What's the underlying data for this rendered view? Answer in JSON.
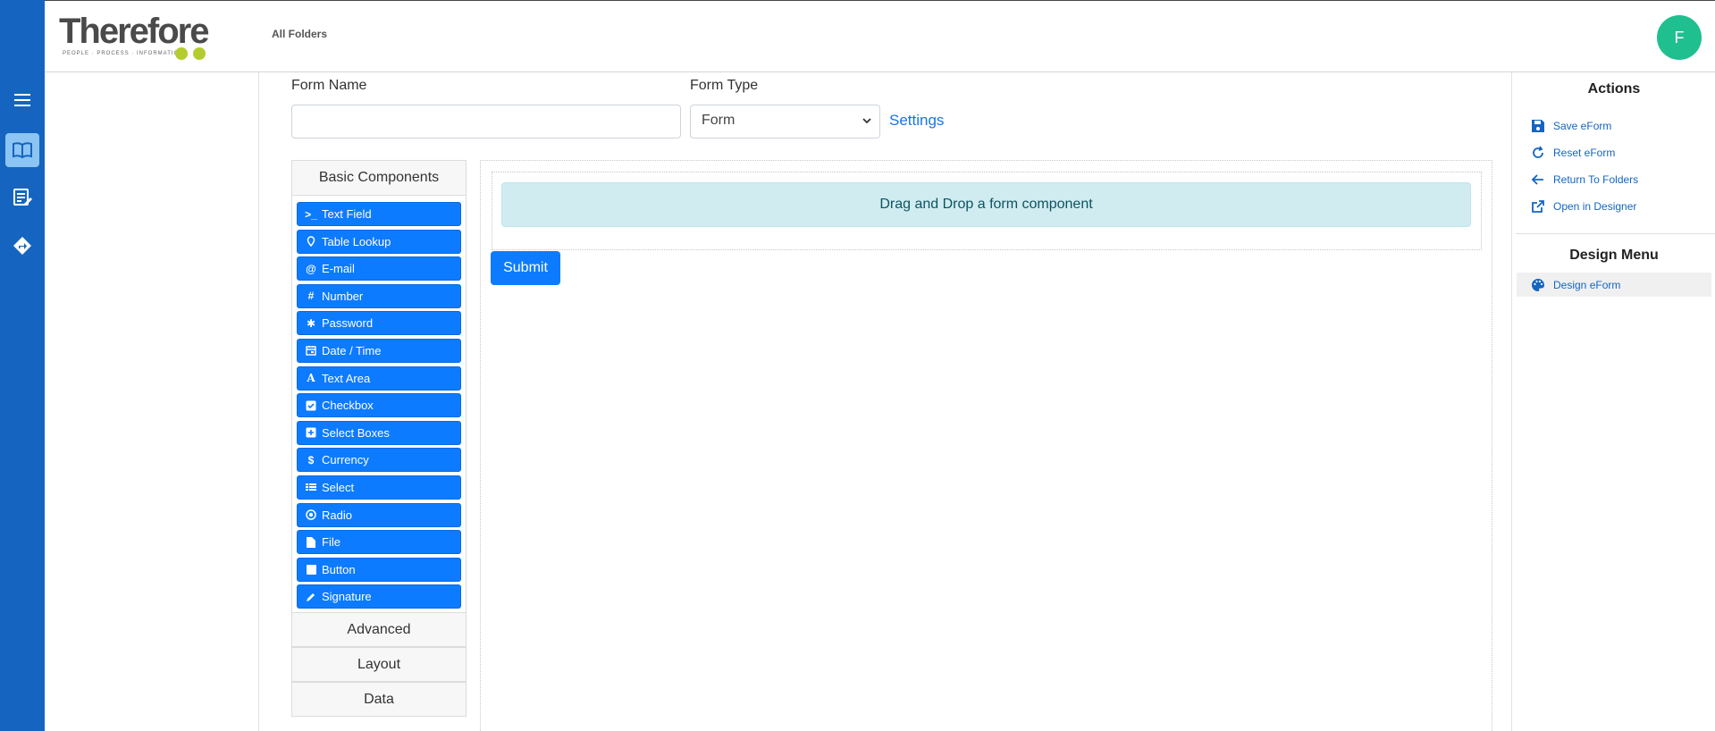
{
  "header": {
    "logo_text": "Therefore",
    "logo_tagline": "PEOPLE · PROCESS · INFORMATION",
    "breadcrumb": "All Folders",
    "avatar_initial": "F"
  },
  "rail": {
    "icons": [
      "menu-icon",
      "book-icon",
      "edit-list-icon",
      "directions-icon"
    ],
    "accent_color": "#1565c0"
  },
  "form": {
    "name_label": "Form Name",
    "name_value": "",
    "type_label": "Form Type",
    "type_value": "Form",
    "settings_link": "Settings"
  },
  "components": {
    "basic_header": "Basic Components",
    "items": [
      {
        "label": "Text Field",
        "icon": "terminal-icon"
      },
      {
        "label": "Table Lookup",
        "icon": "map-marker-icon"
      },
      {
        "label": "E-mail",
        "icon": "at-icon"
      },
      {
        "label": "Number",
        "icon": "hashtag-icon"
      },
      {
        "label": "Password",
        "icon": "asterisk-icon"
      },
      {
        "label": "Date / Time",
        "icon": "calendar-icon"
      },
      {
        "label": "Text Area",
        "icon": "font-icon"
      },
      {
        "label": "Checkbox",
        "icon": "check-square-icon"
      },
      {
        "label": "Select Boxes",
        "icon": "plus-square-icon"
      },
      {
        "label": "Currency",
        "icon": "dollar-icon"
      },
      {
        "label": "Select",
        "icon": "list-icon"
      },
      {
        "label": "Radio",
        "icon": "dot-circle-icon"
      },
      {
        "label": "File",
        "icon": "file-icon"
      },
      {
        "label": "Button",
        "icon": "stop-icon"
      },
      {
        "label": "Signature",
        "icon": "pencil-icon"
      }
    ],
    "advanced_header": "Advanced",
    "layout_header": "Layout",
    "data_header": "Data",
    "button_color": "#0d7bff"
  },
  "canvas": {
    "dropzone_text": "Drag and Drop a form component",
    "submit_label": "Submit"
  },
  "actions": {
    "title": "Actions",
    "items": [
      {
        "label": "Save eForm",
        "icon": "save-icon"
      },
      {
        "label": "Reset eForm",
        "icon": "refresh-icon"
      },
      {
        "label": "Return To Folders",
        "icon": "arrow-left-icon"
      },
      {
        "label": "Open in Designer",
        "icon": "external-link-icon"
      }
    ]
  },
  "design_menu": {
    "title": "Design Menu",
    "items": [
      {
        "label": "Design eForm",
        "icon": "palette-icon"
      }
    ]
  }
}
